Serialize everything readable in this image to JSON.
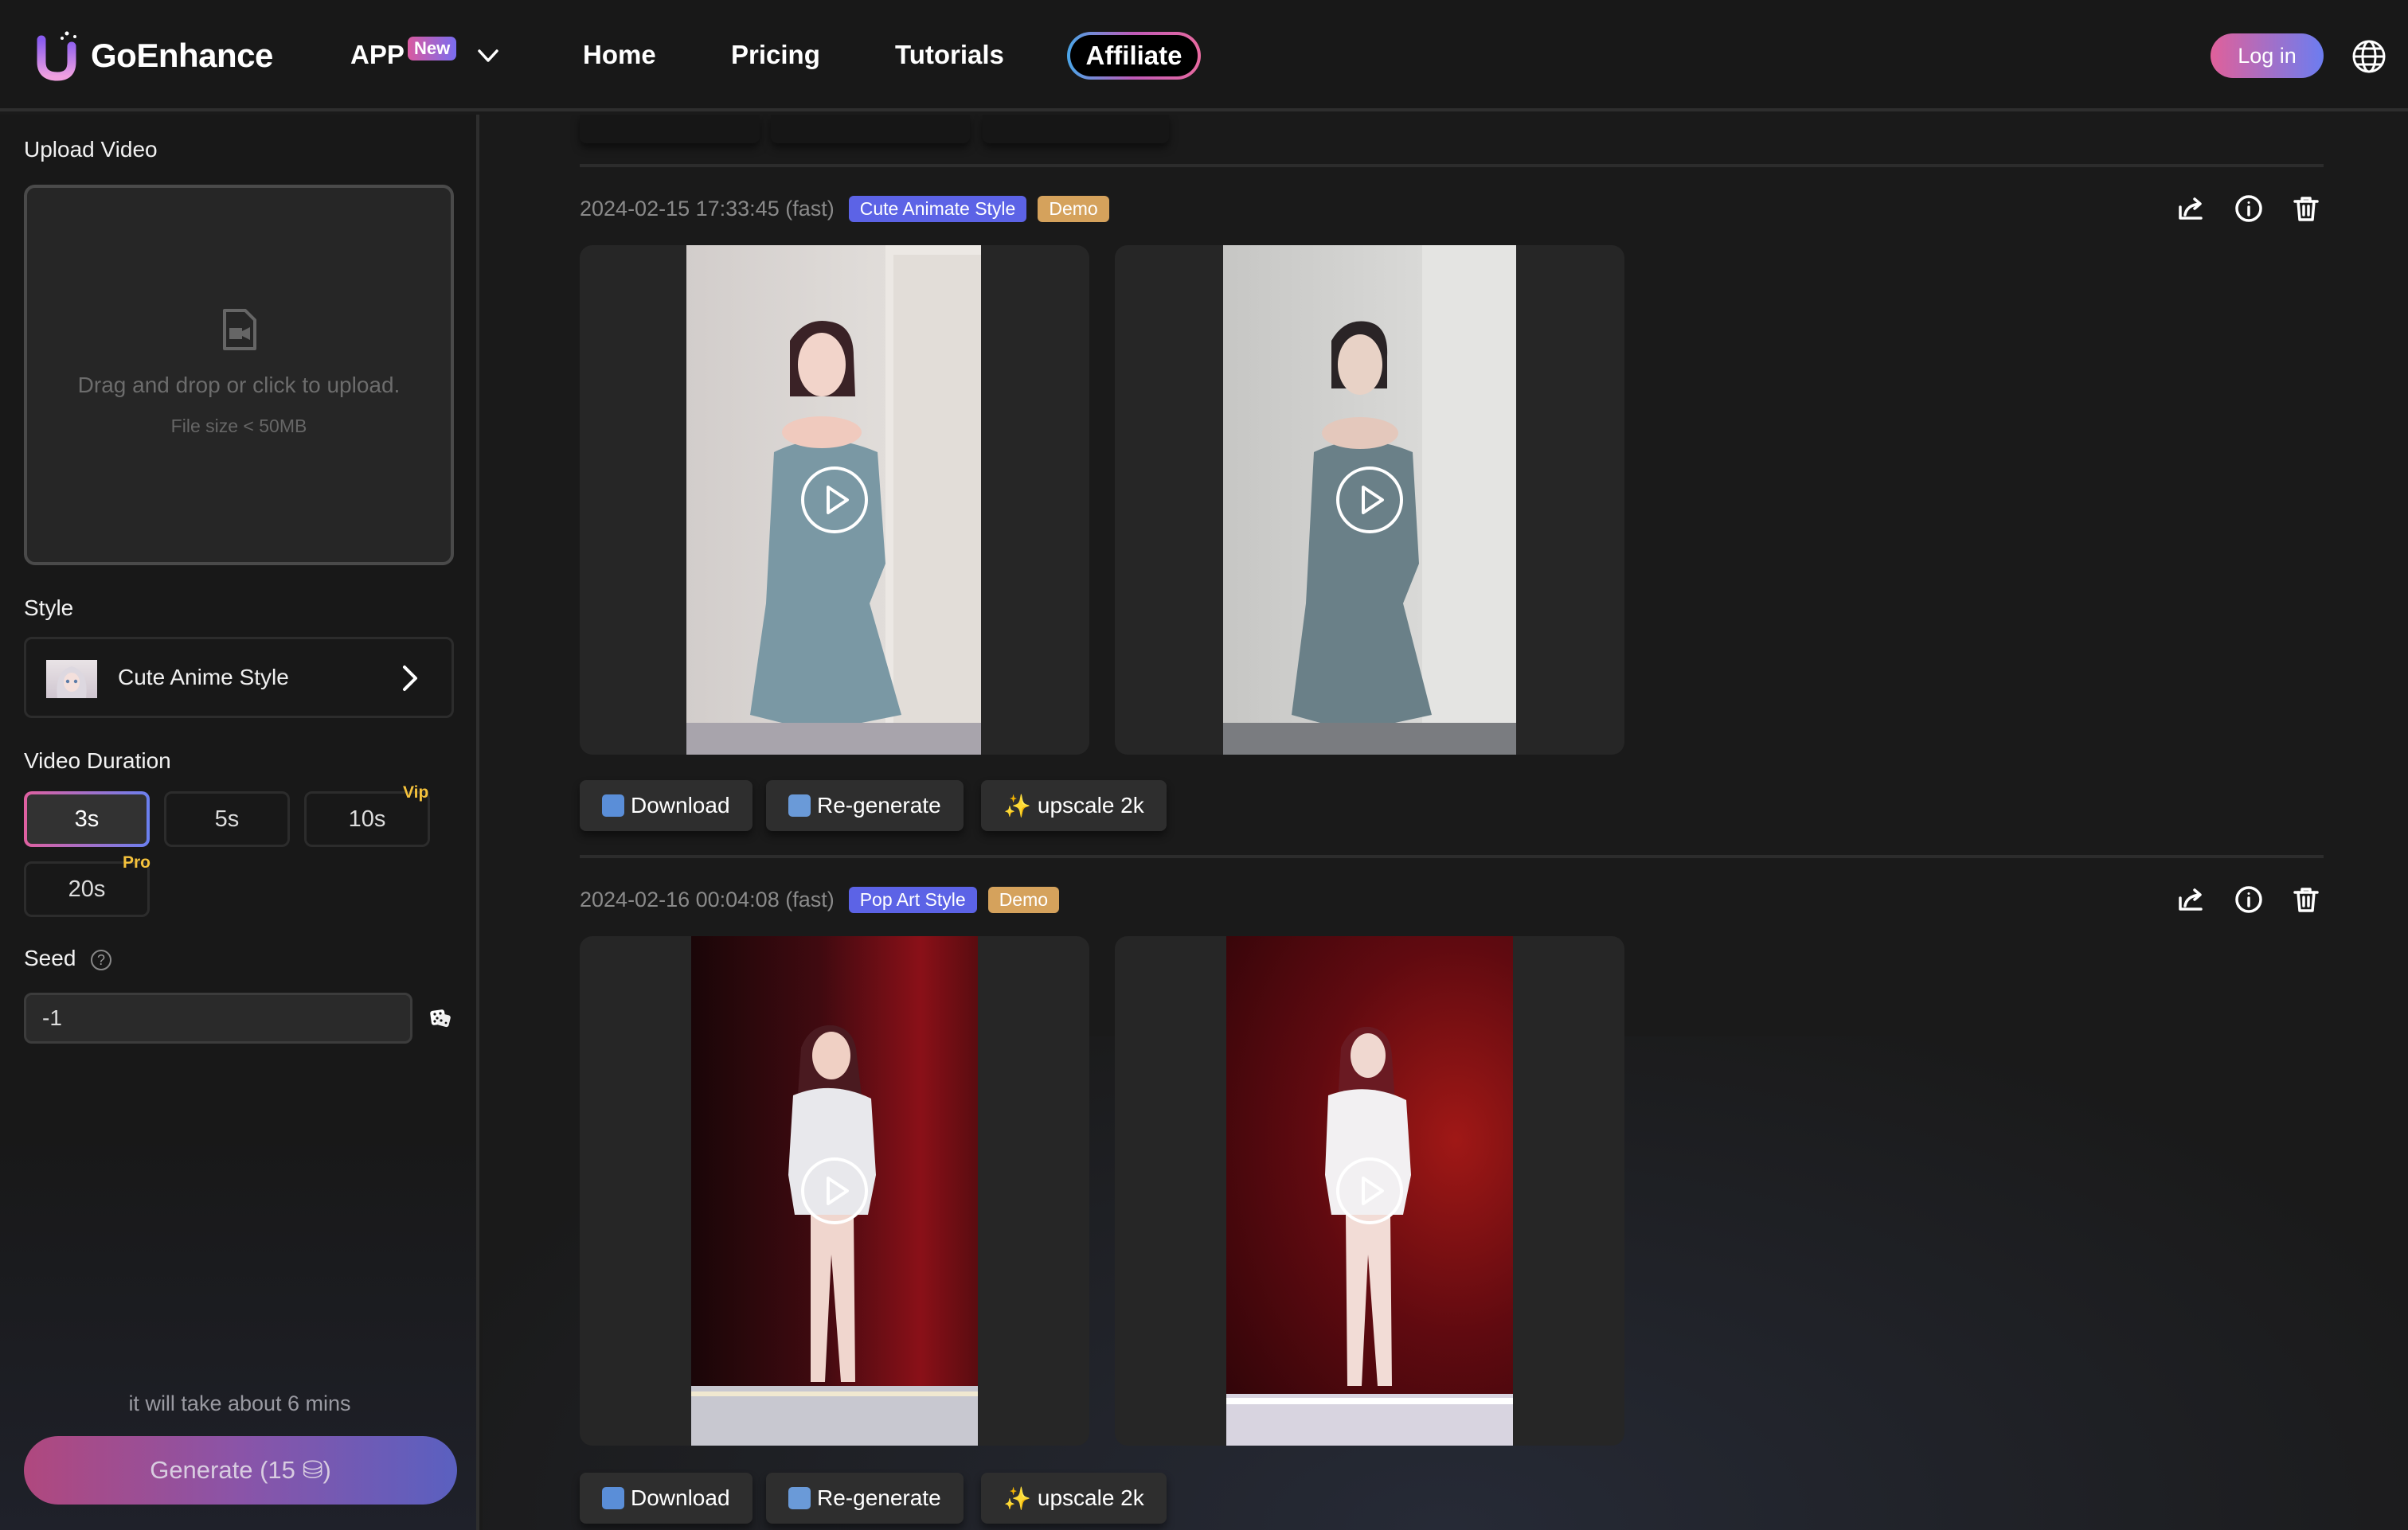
{
  "header": {
    "brand": "GoEnhance",
    "nav": {
      "app": "APP",
      "app_badge": "New",
      "home": "Home",
      "pricing": "Pricing",
      "tutorials": "Tutorials",
      "affiliate": "Affiliate"
    },
    "login": "Log in",
    "language_icon": "globe-icon"
  },
  "sidebar": {
    "upload": {
      "label": "Upload Video",
      "prompt": "Drag and drop or click to upload.",
      "limit": "File size < 50MB"
    },
    "style": {
      "label": "Style",
      "selected": "Cute Anime Style"
    },
    "duration": {
      "label": "Video Duration",
      "options": [
        {
          "label": "3s",
          "tier": "",
          "selected": true
        },
        {
          "label": "5s",
          "tier": "",
          "selected": false
        },
        {
          "label": "10s",
          "tier": "Vip",
          "selected": false
        },
        {
          "label": "20s",
          "tier": "Pro",
          "selected": false
        }
      ]
    },
    "seed": {
      "label": "Seed",
      "help": "?",
      "value": "-1"
    },
    "eta": "it will take about 6 mins",
    "generate": "Generate (15 ⛁)"
  },
  "entries": [
    {
      "timestamp": "2024-02-15 17:33:45 (fast)",
      "style_tag": "Cute Animate Style",
      "demo_tag": "Demo",
      "actions": {
        "download": "Download",
        "regenerate": "Re-generate",
        "upscale": "upscale 2k"
      }
    },
    {
      "timestamp": "2024-02-16 00:04:08 (fast)",
      "style_tag": "Pop Art Style",
      "demo_tag": "Demo",
      "actions": {
        "download": "Download",
        "regenerate": "Re-generate",
        "upscale": "upscale 2k"
      }
    }
  ],
  "colors": {
    "accent_pink": "#e0609a",
    "accent_blue": "#6c7df0",
    "tag_style": "#5c63e6",
    "tag_demo": "#d5a25c",
    "tier_gold": "#f5c23c"
  }
}
